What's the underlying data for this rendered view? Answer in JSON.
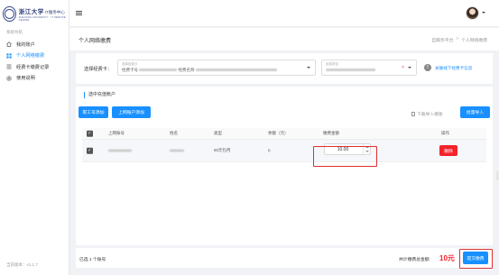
{
  "logo": {
    "title": "浙江大学",
    "badge": "IT服务中心",
    "sub": "ZHEJIANG UNIVERSITY · IT SERVICE CENTER"
  },
  "sidebar": {
    "section_label": "系统导航",
    "items": [
      {
        "label": "我的账户",
        "icon": "home-icon",
        "active": false
      },
      {
        "label": "个人网络缴费",
        "icon": "grid-icon",
        "active": true
      },
      {
        "label": "经费卡缴费记录",
        "icon": "list-icon",
        "active": false
      },
      {
        "label": "使用说明",
        "icon": "gear-icon",
        "active": false
      }
    ],
    "version": "当前版本：v1.1.7"
  },
  "header": {
    "avatar": "avatar"
  },
  "titlebar": {
    "page_title": "个人网络缴费",
    "breadcrumb": [
      "自服务平台",
      ">",
      "个人网络缴费"
    ]
  },
  "filter": {
    "label": "选择经费卡：",
    "card_select": {
      "placeholder": "选择经费卡",
      "value": "经费卡号",
      "value_suffix": "经费名称"
    },
    "project_select": {
      "placeholder": "经费项目",
      "value": "",
      "clear": "×"
    },
    "info_link": "关联线下经费卡信息"
  },
  "main": {
    "section_title": "选中充值帐户",
    "buttons": {
      "add_staff": "职工号添加",
      "add_account": "上网账户添加",
      "download_template": "下载导入模板",
      "batch_import": "批量导入"
    },
    "table": {
      "headers": [
        "上网账号",
        "姓名",
        "类型",
        "余额（元）",
        "缴费金额",
        "操作"
      ],
      "rows": [
        {
          "account": "",
          "name": "",
          "type": "50元包月",
          "balance": "0",
          "amount": "10.00",
          "action": "删除"
        }
      ]
    }
  },
  "footer": {
    "selected_count": "已选 1 个账号",
    "total_label": "共计缴费总金额:",
    "total_value": "10元",
    "submit": "提交缴费"
  },
  "colors": {
    "accent": "#1890ff",
    "danger": "#f5222d",
    "highlight_frame": "#e03030"
  }
}
